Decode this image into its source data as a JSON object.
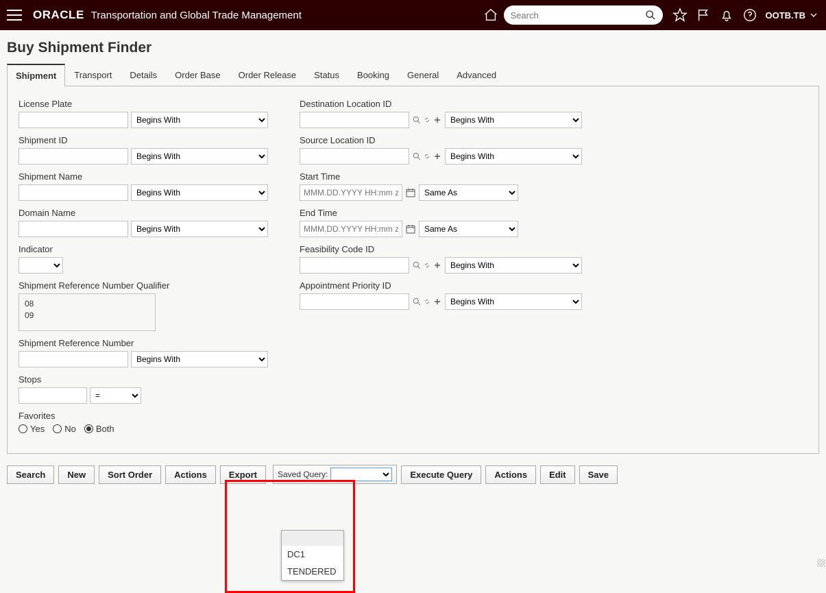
{
  "header": {
    "brand": "ORACLE",
    "product": "Transportation and Global Trade Management",
    "search_placeholder": "Search",
    "user": "OOTB.TB"
  },
  "page_title": "Buy Shipment Finder",
  "tabs": [
    {
      "label": "Shipment",
      "active": true
    },
    {
      "label": "Transport"
    },
    {
      "label": "Details"
    },
    {
      "label": "Order Base"
    },
    {
      "label": "Order Release"
    },
    {
      "label": "Status"
    },
    {
      "label": "Booking"
    },
    {
      "label": "General"
    },
    {
      "label": "Advanced"
    }
  ],
  "left_fields": {
    "license_plate": "License Plate",
    "shipment_id": "Shipment ID",
    "shipment_name": "Shipment Name",
    "domain_name": "Domain Name",
    "indicator": "Indicator",
    "ref_qualifier": "Shipment Reference Number Qualifier",
    "ref_qualifier_opts": [
      "08",
      "09"
    ],
    "ref_number": "Shipment Reference Number",
    "stops": "Stops",
    "favorites": "Favorites"
  },
  "right_fields": {
    "dest_loc": "Destination Location ID",
    "src_loc": "Source Location ID",
    "start_time": "Start Time",
    "end_time": "End Time",
    "feasibility": "Feasibility Code ID",
    "appt_priority": "Appointment Priority ID",
    "date_placeholder": "MMM.DD.YYYY HH:mm z"
  },
  "operators": {
    "begins_with": "Begins With",
    "same_as": "Same As",
    "equals": "="
  },
  "favorites_opts": {
    "yes": "Yes",
    "no": "No",
    "both": "Both"
  },
  "buttons": {
    "search": "Search",
    "new": "New",
    "sort_order": "Sort Order",
    "actions": "Actions",
    "export": "Export",
    "saved_query_label": "Saved Query:",
    "execute_query": "Execute Query",
    "actions2": "Actions",
    "edit": "Edit",
    "save": "Save"
  },
  "saved_query_opts": [
    "",
    "DC1",
    "TENDERED"
  ]
}
